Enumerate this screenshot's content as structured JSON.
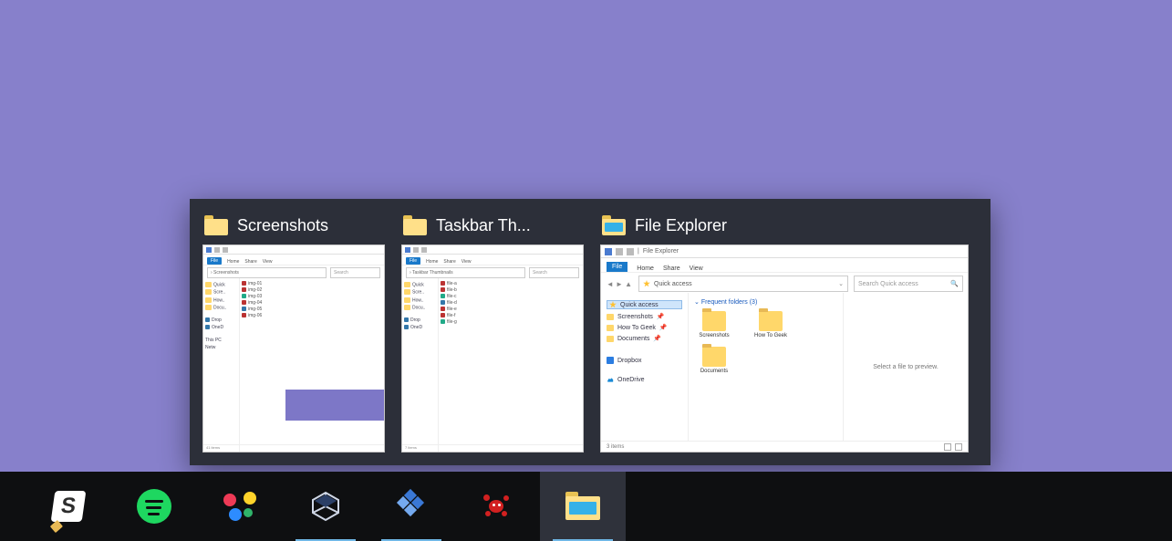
{
  "previews": [
    {
      "title": "Screenshots",
      "icon": "folder"
    },
    {
      "title": "Taskbar Th...",
      "icon": "folder"
    },
    {
      "title": "File Explorer",
      "icon": "explorer"
    }
  ],
  "explorer_thumb": {
    "title_suffix": "File Explorer",
    "ribbon": {
      "file": "File",
      "tabs": [
        "Home",
        "Share",
        "View"
      ]
    },
    "address": "Quick access",
    "search_placeholder": "Search Quick access",
    "sidebar": {
      "quick_access": "Quick access",
      "items": [
        "Screenshots",
        "How To Geek",
        "Documents"
      ],
      "dropbox": "Dropbox",
      "onedrive": "OneDrive"
    },
    "content": {
      "section": "Frequent folders (3)",
      "folders": [
        "Screenshots",
        "How To Geek",
        "Documents"
      ]
    },
    "preview_msg": "Select a file to preview.",
    "status": "3 items"
  },
  "taskbar": {
    "apps": [
      {
        "name": "slack",
        "running": false,
        "active": false
      },
      {
        "name": "spotify",
        "running": false,
        "active": false
      },
      {
        "name": "paint",
        "running": false,
        "active": false
      },
      {
        "name": "virtualbox",
        "running": true,
        "active": false
      },
      {
        "name": "regedit",
        "running": true,
        "active": false
      },
      {
        "name": "irfanview",
        "running": false,
        "active": false
      },
      {
        "name": "explorer",
        "running": true,
        "active": true
      }
    ]
  }
}
